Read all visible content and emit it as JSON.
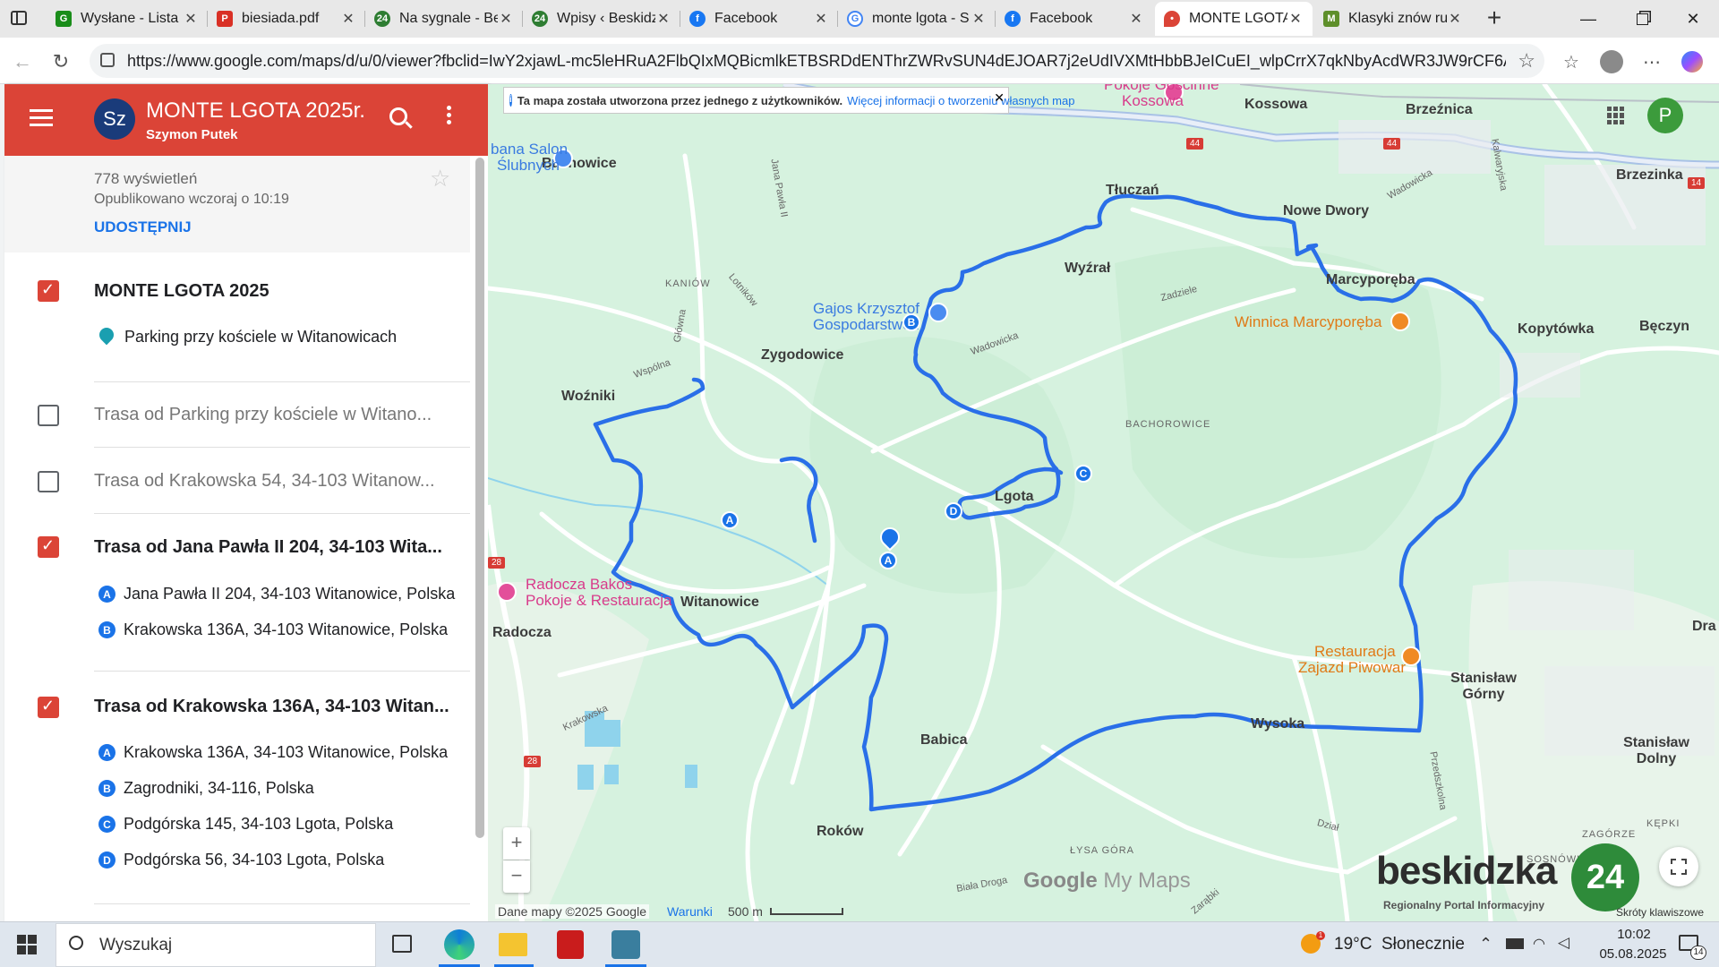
{
  "browser": {
    "tabs": [
      {
        "title": "Wysłane - Lista",
        "favicon_color": "#1a8d1a",
        "active": false
      },
      {
        "title": "biesiada.pdf",
        "favicon_color": "#d93025",
        "active": false
      },
      {
        "title": "Na sygnale - Be",
        "favicon_color": "#2e7d32",
        "active": false
      },
      {
        "title": "Wpisy ‹ Beskidz",
        "favicon_color": "#2e7d32",
        "active": false
      },
      {
        "title": "Facebook",
        "favicon_color": "#1877f2",
        "active": false
      },
      {
        "title": "monte lgota - S",
        "favicon_color": "#4285f4",
        "active": false
      },
      {
        "title": "Facebook",
        "favicon_color": "#1877f2",
        "active": false
      },
      {
        "title": "MONTE LGOTA",
        "favicon_color": "#db4437",
        "active": true
      },
      {
        "title": "Klasyki znów ru",
        "favicon_color": "#5e8f2a",
        "active": false
      }
    ],
    "url": "https://www.google.com/maps/d/u/0/viewer?fbclid=IwY2xjawL-mc5leHRuA2FlbQIxMQBicmlkETBSRDdENThrZWRvSUN4dEJOAR7j2eUdIVXMtHbbBJeICuEI_wlpCrrX7qkNbyAcdWR3JW9rCF6AFzhJsR..."
  },
  "panel": {
    "title": "MONTE LGOTA 2025r.",
    "author": "Szymon Putek",
    "avatar_initials": "Sz",
    "views": "778 wyświetleń",
    "published": "Opublikowano wczoraj o 10:19",
    "share_label": "UDOSTĘPNIJ",
    "layers": [
      {
        "title": "MONTE LGOTA 2025",
        "checked": true,
        "points": [
          {
            "marker": "pin",
            "label": "Parking przy kościele w Witanowicach"
          }
        ]
      },
      {
        "title": "Trasa od Parking przy kościele w Witano...",
        "checked": false,
        "points": []
      },
      {
        "title": "Trasa od Krakowska 54, 34-103 Witanow...",
        "checked": false,
        "points": []
      },
      {
        "title": "Trasa od Jana Pawła II 204, 34-103 Wita...",
        "checked": true,
        "points": [
          {
            "marker": "A",
            "label": "Jana Pawła II 204, 34-103 Witanowice, Polska"
          },
          {
            "marker": "B",
            "label": "Krakowska 136A, 34-103 Witanowice, Polska"
          }
        ]
      },
      {
        "title": "Trasa od Krakowska 136A, 34-103 Witan...",
        "checked": true,
        "points": [
          {
            "marker": "A",
            "label": "Krakowska 136A, 34-103 Witanowice, Polska"
          },
          {
            "marker": "B",
            "label": "Zagrodniki, 34-116, Polska"
          },
          {
            "marker": "C",
            "label": "Podgórska 145, 34-103 Lgota, Polska"
          },
          {
            "marker": "D",
            "label": "Podgórska 56, 34-103 Lgota, Polska"
          }
        ]
      }
    ]
  },
  "map": {
    "notice_text": "Ta mapa została utworzona przez jednego z użytkowników.",
    "notice_link": "Więcej informacji o tworzeniu własnych map",
    "user_initial": "P",
    "route_color": "#2a6fe8",
    "places": {
      "bachowice": "Bachowice",
      "kossowa": "Kossowa",
      "brzeznica": "Brzeźnica",
      "brzezinka": "Brzezinka",
      "tluczan": "Tłuczań",
      "nowe_dwory": "Nowe Dwory",
      "wyzral": "Wyźrał",
      "zygodowice": "Zygodowice",
      "marcyporeba": "Marcyporęba",
      "kopytowka": "Kopytówka",
      "beczyn": "Bęczyn",
      "wozniki": "Woźniki",
      "lgota": "Lgota",
      "witanowice": "Witanowice",
      "radocza": "Radocza",
      "babica": "Babica",
      "wysoka": "Wysoka",
      "stanislaw_gorny": "Stanisław Górny",
      "stanislaw_dolny": "Stanisław Dolny",
      "rokow": "Roków",
      "dra": "Dra",
      "kaniow": "KANIÓW",
      "bachorowice": "BACHOROWICE",
      "lysa_gora": "ŁYSA GÓRA",
      "zagorze": "ZAGÓRZE",
      "kepki": "KĘPKI",
      "sosnowka": "SOSNÓWKA"
    },
    "roads": {
      "jana_pawla": "Jana Pawła II",
      "lotnikow": "Lotników",
      "glowna": "Główna",
      "wadowicka": "Wadowicka",
      "zadziele": "Zadziele",
      "wspolna": "Wspólna",
      "krakowska": "Krakowska",
      "przedszkolna": "Przedszkolna",
      "dzial": "Dział",
      "biala_droga": "Biała Droga",
      "zarabki": "Zarąbki",
      "kalwaryjska": "Kalwaryjska"
    },
    "road_numbers": [
      "44",
      "44",
      "14",
      "28",
      "28"
    ],
    "pois": [
      {
        "name": "Pokoje Gościnne Kossowa",
        "color": "#e34f9a",
        "icon": "bed-icon"
      },
      {
        "name": "Suknie Ślubne Salon",
        "color": "#4a8cf0",
        "icon": "shopping-bag-icon"
      },
      {
        "name": "Gajos Krzysztof Gospodarstwo...",
        "color": "#4a8cf0",
        "icon": "shopping-bag-icon"
      },
      {
        "name": "Winnica Marcyporęba",
        "color": "#f08a24",
        "icon": "wine-icon"
      },
      {
        "name": "Radocza Bakos Pokoje & Restauracja",
        "color": "#e34f9a",
        "icon": "bed-icon"
      },
      {
        "name": "Restauracja Zajazd Piwowar",
        "color": "#f08a24",
        "icon": "fork-knife-icon"
      }
    ],
    "poi_labels": {
      "kossowa_1": "Pokoje Gościnne",
      "kossowa_2": "Kossowa",
      "salon_1": "bana Salon",
      "salon_2": "Ślubnych",
      "gajos_1": "Gajos Krzysztof",
      "gajos_2": "Gospodarstwo...",
      "winnica": "Winnica Marcyporęba",
      "radocza_1": "Radocza Bakos",
      "radocza_2": "Pokoje & Restauracja",
      "piwowar_1": "Restauracja",
      "piwowar_2": "Zajazd Piwowar"
    },
    "markers": [
      "A",
      "B",
      "C",
      "D",
      "A"
    ],
    "zoom_in": "+",
    "zoom_out": "−",
    "attribution": "Dane mapy ©2025 Google",
    "terms": "Warunki",
    "scale": "500 m",
    "google_logo": "Google",
    "my_maps": "My Maps",
    "watermark_brand": "beskidzka",
    "watermark_num": "24",
    "watermark_tag": "Regionalny Portal Informacyjny",
    "shortcuts": "Skróty klawiszowe"
  },
  "taskbar": {
    "search_placeholder": "Wyszukaj",
    "weather": "19°C  Słonecznie",
    "weather_badge": "1",
    "time": "10:02",
    "date": "05.08.2025",
    "notifications": "14"
  }
}
